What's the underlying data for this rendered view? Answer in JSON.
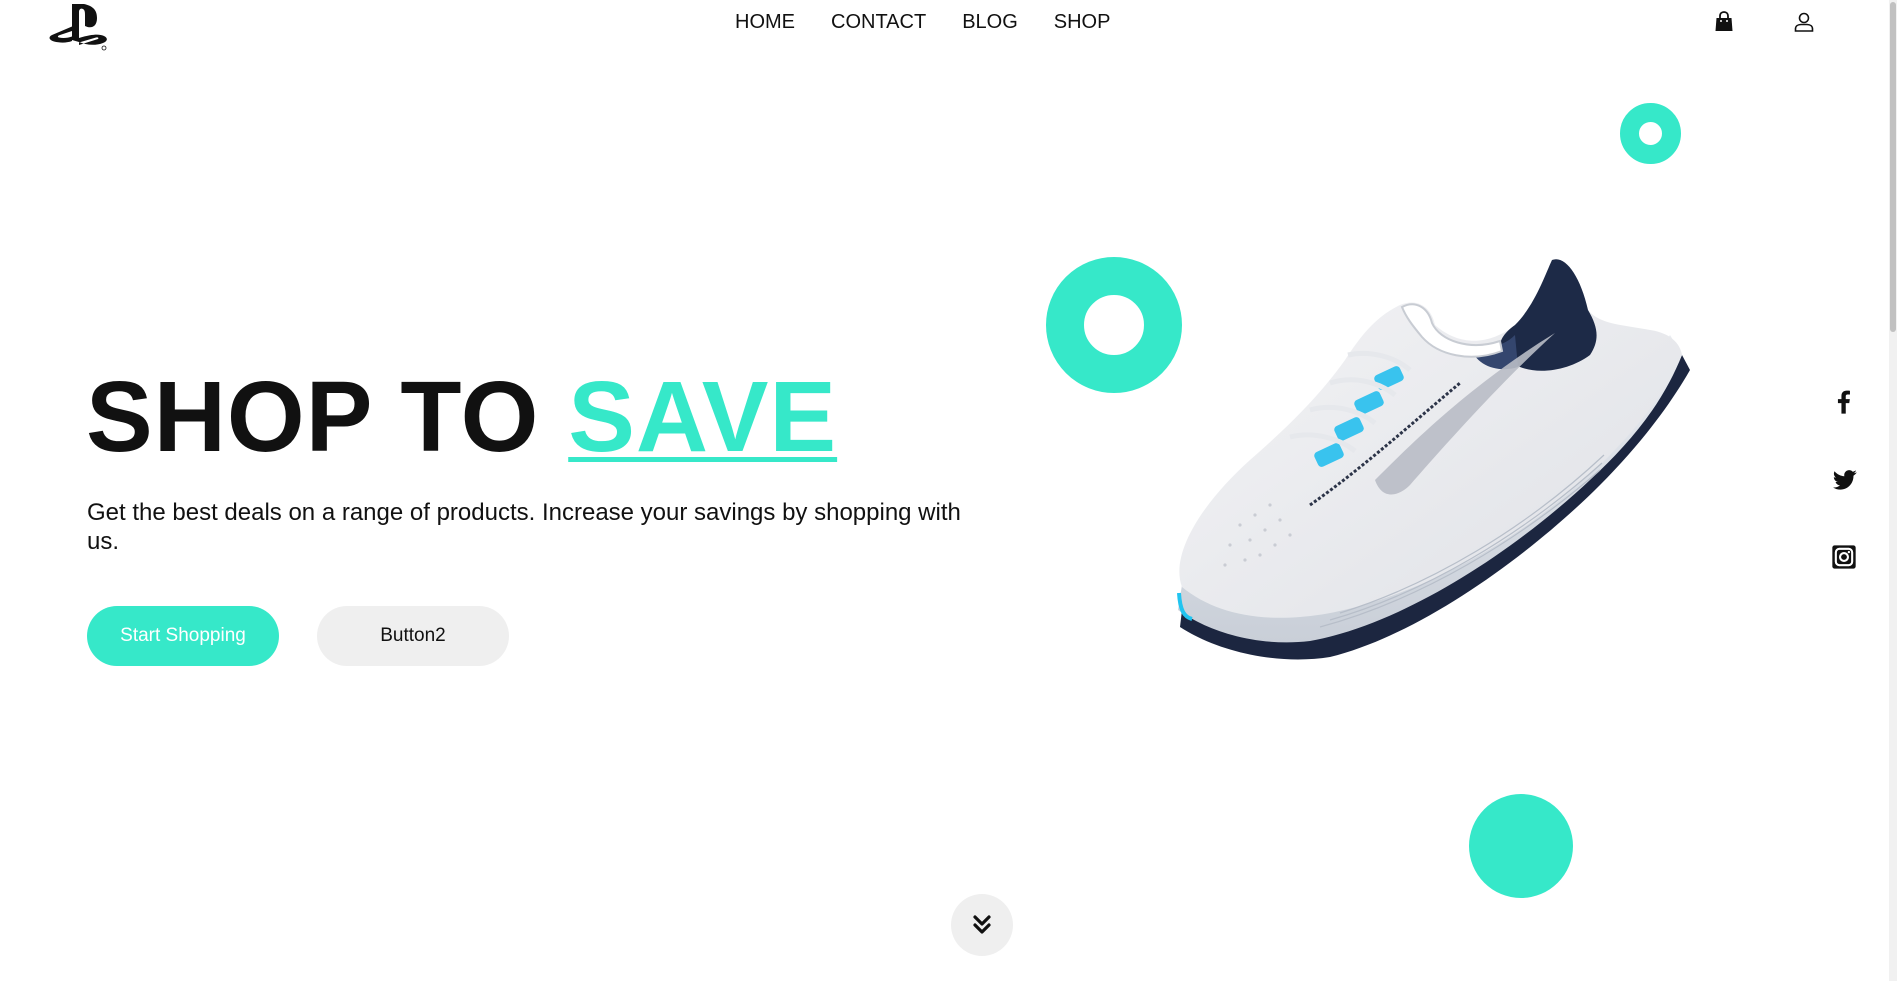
{
  "brand": {
    "logo_icon": "playstation-logo-icon"
  },
  "nav": {
    "items": [
      {
        "label": "HOME"
      },
      {
        "label": "CONTACT"
      },
      {
        "label": "BLOG"
      },
      {
        "label": "SHOP"
      }
    ]
  },
  "header_icons": {
    "cart": "shopping-bag-icon",
    "account": "user-icon"
  },
  "hero": {
    "title_main": "SHOP TO ",
    "title_accent": "SAVE",
    "subtitle": "Get the best deals on a range of products. Increase your savings by shopping with us.",
    "primary_button": "Start Shopping",
    "secondary_button": "Button2",
    "image_icon": "running-shoe-image"
  },
  "social": [
    {
      "icon": "facebook-icon"
    },
    {
      "icon": "twitter-icon"
    },
    {
      "icon": "instagram-icon"
    }
  ],
  "scroll_indicator": {
    "icon": "double-chevron-down-icon"
  },
  "colors": {
    "accent": "#36e8c9",
    "text": "#111111",
    "button_secondary_bg": "#efefef",
    "background": "#ffffff"
  }
}
